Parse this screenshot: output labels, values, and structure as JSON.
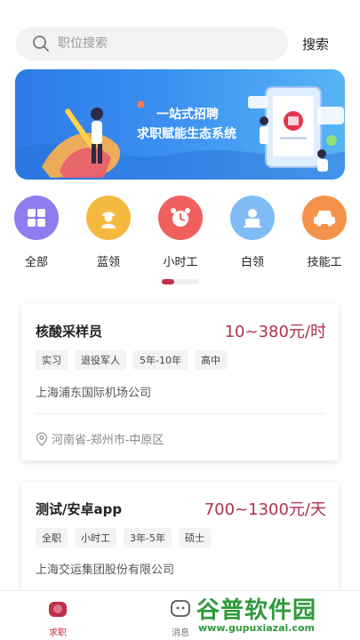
{
  "search": {
    "placeholder": "职位搜索",
    "button_label": "搜索"
  },
  "banner": {
    "line1": "一站式招聘",
    "line2": "求职赋能生态系统"
  },
  "categories": [
    {
      "label": "全部",
      "icon": "grid-icon",
      "color": "#8f7cf0"
    },
    {
      "label": "蓝领",
      "icon": "worker-icon",
      "color": "#f6b940"
    },
    {
      "label": "小时工",
      "icon": "alarm-clock-icon",
      "color": "#f0605f"
    },
    {
      "label": "白领",
      "icon": "office-worker-icon",
      "color": "#7fbcf5"
    },
    {
      "label": "技能工",
      "icon": "car-icon",
      "color": "#f5924a"
    }
  ],
  "jobs": [
    {
      "title": "核酸采样员",
      "salary": "10~380元/时",
      "tags": [
        "实习",
        "退役军人",
        "5年-10年",
        "高中"
      ],
      "company": "上海浦东国际机场公司",
      "location": "河南省-郑州市-中原区"
    },
    {
      "title": "测试/安卓app",
      "salary": "700~1300元/天",
      "tags": [
        "全职",
        "小时工",
        "3年-5年",
        "硕士"
      ],
      "company": "上海交运集团股份有限公司"
    }
  ],
  "tabbar": {
    "items": [
      {
        "label": "求职",
        "active": true
      },
      {
        "label": "消息",
        "active": false
      }
    ]
  },
  "watermark": {
    "main": "谷普软件园",
    "url": "www.gupuxiazai.com"
  },
  "colors": {
    "accent": "#b03050",
    "indicator": "#c0304a"
  }
}
